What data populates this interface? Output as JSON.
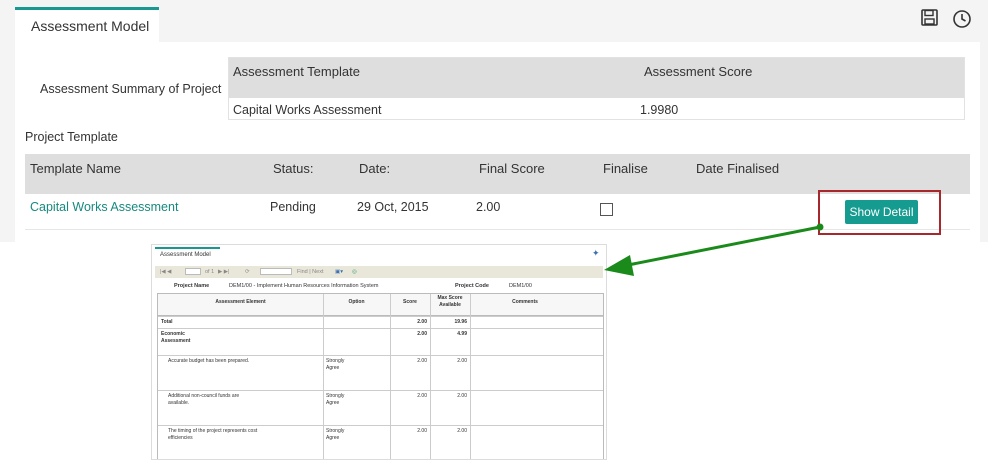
{
  "panel": {
    "tab_label": "Assessment Model",
    "summary_label": "Assessment Summary of Project",
    "summary_table": {
      "headers": [
        "Assessment Template",
        "Assessment Score"
      ],
      "rows": [
        [
          "Capital Works Assessment",
          "1.9980"
        ]
      ]
    },
    "section_label": "Project Template",
    "template_table": {
      "headers": [
        "Template Name",
        "Status:",
        "Date:",
        "Final Score",
        "Finalise",
        "Date Finalised"
      ],
      "row": {
        "name": "Capital Works Assessment",
        "status": "Pending",
        "date": "29 Oct, 2015",
        "final_score": "2.00",
        "finalised": false,
        "date_finalised": ""
      },
      "show_detail_label": "Show Detail"
    },
    "icons": [
      "save-icon",
      "history-clock-icon"
    ],
    "accent_color": "#159b90",
    "highlight_color": "#a8272c",
    "arrow_color": "#1a8a1a"
  },
  "inset": {
    "tab_label": "Assessment Model",
    "toolbar": {
      "page_of": "of 1",
      "find_next": "Find | Next"
    },
    "project_name_label": "Project Name",
    "project_name": "DEM1/00 - Implement Human Resources Information System",
    "project_code_label": "Project Code",
    "project_code": "DEM1/00",
    "grid_headers": [
      "Assessment Element",
      "Option",
      "Score",
      "Max Score Available",
      "Comments"
    ],
    "rows": [
      {
        "element": "Total",
        "option": "",
        "score": "2.00",
        "max": "19.96"
      },
      {
        "element": "Economic Assessment",
        "option": "",
        "score": "2.00",
        "max": "4.99"
      },
      {
        "element": "Accurate budget has been prepared.",
        "option": "Strongly Agree",
        "score": "2.00",
        "max": "2.00"
      },
      {
        "element": "Additional non-council funds are available.",
        "option": "Strongly Agree",
        "score": "2.00",
        "max": "2.00"
      },
      {
        "element": "The timing of the project represents cost efficiencies",
        "option": "Strongly Agree",
        "score": "2.00",
        "max": "2.00"
      }
    ]
  }
}
